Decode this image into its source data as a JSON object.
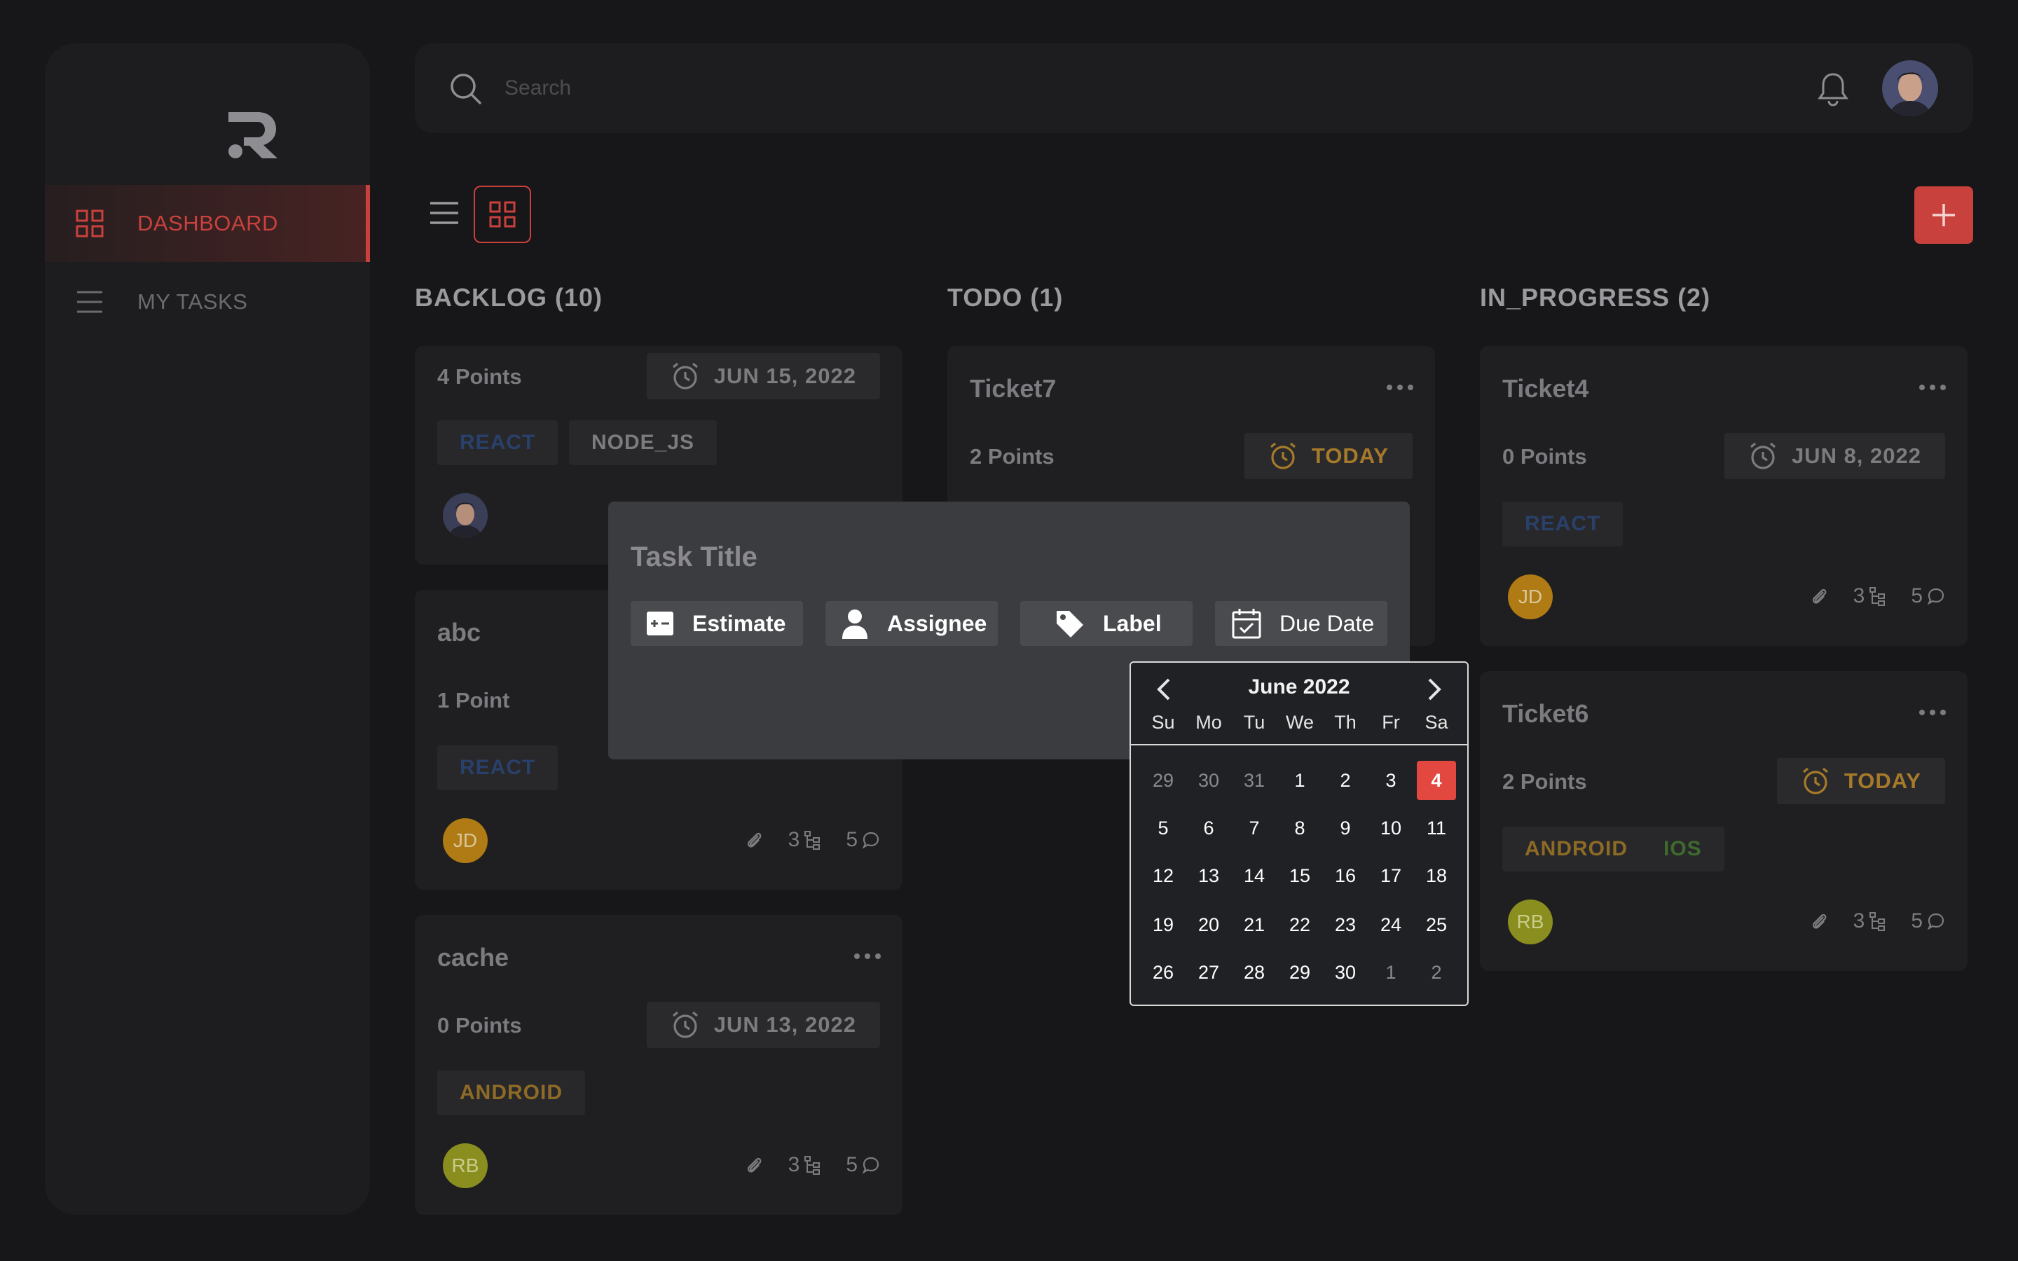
{
  "sidebar": {
    "logo_icon": "r-logo-icon",
    "items": [
      {
        "label": "DASHBOARD",
        "icon": "grid-icon",
        "active": true
      },
      {
        "label": "MY TASKS",
        "icon": "list-icon",
        "active": false
      }
    ]
  },
  "header": {
    "search_placeholder": "Search",
    "bell_icon": "bell-icon",
    "avatar": "user-avatar"
  },
  "toolbar": {
    "list_view_icon": "list-view-icon",
    "grid_view_icon": "grid-view-icon",
    "add_icon": "plus-icon"
  },
  "colors": {
    "accent": "#c9413d",
    "background": "#171719",
    "panel": "#1d1d1f",
    "selected_day": "#e2483f"
  },
  "columns": [
    {
      "title": "BACKLOG (10)",
      "cards": [
        {
          "title": "",
          "points": "4 Points",
          "date": "JUN 15, 2022",
          "tags": [
            "REACT",
            "NODE_JS"
          ],
          "assignee": "photo"
        },
        {
          "title": "abc",
          "points": "1 Point",
          "tags": [
            "REACT"
          ],
          "assignee": "JD",
          "attachments": "",
          "subtasks": "3",
          "comments": "5"
        },
        {
          "title": "cache",
          "points": "0 Points",
          "date": "JUN 13, 2022",
          "tags": [
            "ANDROID"
          ],
          "assignee": "RB",
          "subtasks": "3",
          "comments": "5"
        }
      ]
    },
    {
      "title": "TODO (1)",
      "cards": [
        {
          "title": "Ticket7",
          "points": "2 Points",
          "date": "TODAY"
        }
      ]
    },
    {
      "title": "IN_PROGRESS (2)",
      "cards": [
        {
          "title": "Ticket4",
          "points": "0 Points",
          "date": "JUN 8, 2022",
          "tags": [
            "REACT"
          ],
          "assignee": "JD",
          "subtasks": "3",
          "comments": "5"
        },
        {
          "title": "Ticket6",
          "points": "2 Points",
          "date": "TODAY",
          "tags": [
            "ANDROID",
            "IOS"
          ],
          "assignee": "RB",
          "subtasks": "3",
          "comments": "5"
        }
      ]
    }
  ],
  "modal": {
    "title_placeholder": "Task Title",
    "buttons": [
      {
        "label": "Estimate",
        "icon": "estimate-icon"
      },
      {
        "label": "Assignee",
        "icon": "person-icon"
      },
      {
        "label": "Label",
        "icon": "tag-icon"
      },
      {
        "label": "Due Date",
        "icon": "calendar-icon"
      }
    ]
  },
  "datepicker": {
    "month_label": "June 2022",
    "weekdays": [
      "Su",
      "Mo",
      "Tu",
      "We",
      "Th",
      "Fr",
      "Sa"
    ],
    "weeks": [
      [
        "29",
        "30",
        "31",
        "1",
        "2",
        "3",
        "4"
      ],
      [
        "5",
        "6",
        "7",
        "8",
        "9",
        "10",
        "11"
      ],
      [
        "12",
        "13",
        "14",
        "15",
        "16",
        "17",
        "18"
      ],
      [
        "19",
        "20",
        "21",
        "22",
        "23",
        "24",
        "25"
      ],
      [
        "26",
        "27",
        "28",
        "29",
        "30",
        "1",
        "2"
      ]
    ],
    "muted": [
      [
        0,
        0
      ],
      [
        0,
        1
      ],
      [
        0,
        2
      ],
      [
        4,
        5
      ],
      [
        4,
        6
      ]
    ],
    "selected": [
      0,
      6
    ]
  }
}
